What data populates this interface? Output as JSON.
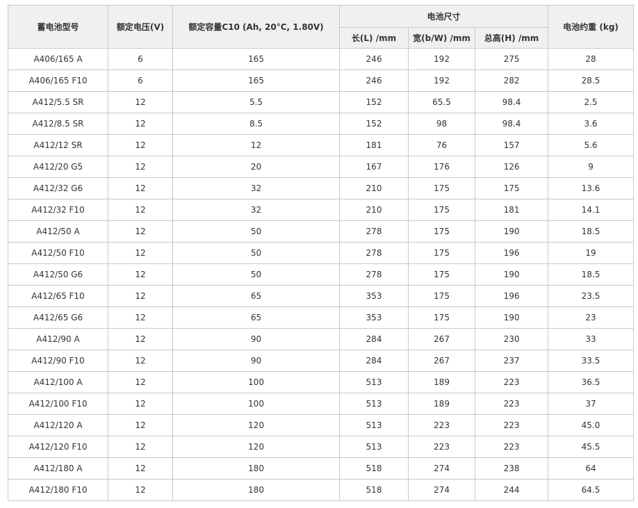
{
  "table": {
    "headers": {
      "model": "蓄电池型号",
      "voltage": "额定电压(V)",
      "capacity": "额定容量C10 (Ah, 20°C, 1.80V)",
      "dimensions": "电池尺寸",
      "length": "长(L) /mm",
      "width": "宽(b/W) /mm",
      "height": "总高(H) /mm",
      "weight": "电池约重 (kg)"
    },
    "rows": [
      [
        "A406/165 A",
        "6",
        "165",
        "246",
        "192",
        "275",
        "28"
      ],
      [
        "A406/165 F10",
        "6",
        "165",
        "246",
        "192",
        "282",
        "28.5"
      ],
      [
        "A412/5.5 SR",
        "12",
        "5.5",
        "152",
        "65.5",
        "98.4",
        "2.5"
      ],
      [
        "A412/8.5 SR",
        "12",
        "8.5",
        "152",
        "98",
        "98.4",
        "3.6"
      ],
      [
        "A412/12 SR",
        "12",
        "12",
        "181",
        "76",
        "157",
        "5.6"
      ],
      [
        "A412/20 G5",
        "12",
        "20",
        "167",
        "176",
        "126",
        "9"
      ],
      [
        "A412/32 G6",
        "12",
        "32",
        "210",
        "175",
        "175",
        "13.6"
      ],
      [
        "A412/32 F10",
        "12",
        "32",
        "210",
        "175",
        "181",
        "14.1"
      ],
      [
        "A412/50 A",
        "12",
        "50",
        "278",
        "175",
        "190",
        "18.5"
      ],
      [
        "A412/50 F10",
        "12",
        "50",
        "278",
        "175",
        "196",
        "19"
      ],
      [
        "A412/50 G6",
        "12",
        "50",
        "278",
        "175",
        "190",
        "18.5"
      ],
      [
        "A412/65 F10",
        "12",
        "65",
        "353",
        "175",
        "196",
        "23.5"
      ],
      [
        "A412/65 G6",
        "12",
        "65",
        "353",
        "175",
        "190",
        "23"
      ],
      [
        "A412/90 A",
        "12",
        "90",
        "284",
        "267",
        "230",
        "33"
      ],
      [
        "A412/90 F10",
        "12",
        "90",
        "284",
        "267",
        "237",
        "33.5"
      ],
      [
        "A412/100 A",
        "12",
        "100",
        "513",
        "189",
        "223",
        "36.5"
      ],
      [
        "A412/100 F10",
        "12",
        "100",
        "513",
        "189",
        "223",
        "37"
      ],
      [
        "A412/120 A",
        "12",
        "120",
        "513",
        "223",
        "223",
        "45.0"
      ],
      [
        "A412/120 F10",
        "12",
        "120",
        "513",
        "223",
        "223",
        "45.5"
      ],
      [
        "A412/180 A",
        "12",
        "180",
        "518",
        "274",
        "238",
        "64"
      ],
      [
        "A412/180 F10",
        "12",
        "180",
        "518",
        "274",
        "244",
        "64.5"
      ]
    ]
  }
}
